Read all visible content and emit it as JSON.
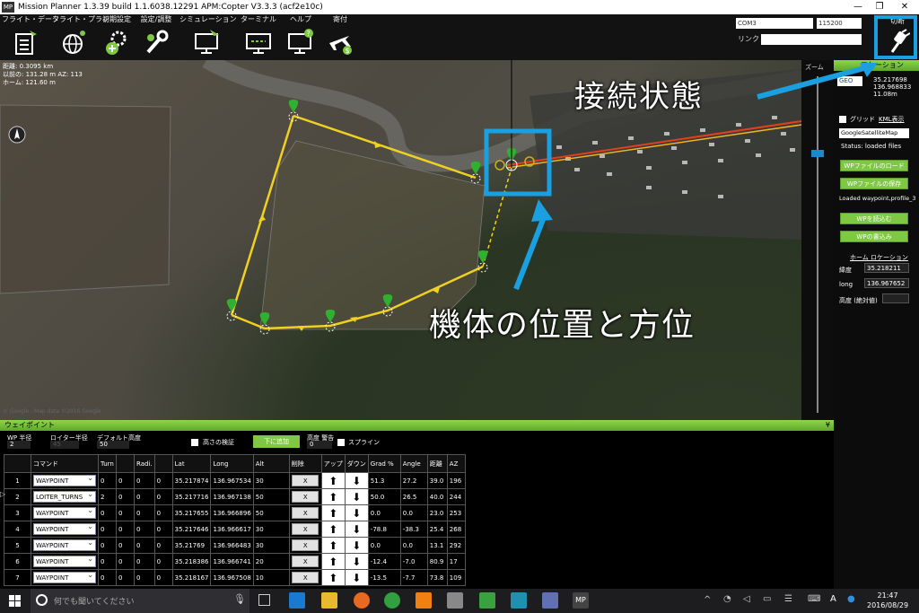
{
  "window": {
    "title": "Mission Planner 1.3.39 build 1.1.6038.12291 APM:Copter V3.3.3 (acf2e10c)",
    "logo": "MP"
  },
  "menu": [
    {
      "label": "フライト・データ",
      "icon": "flight-data-icon"
    },
    {
      "label": "フライト・プラン",
      "icon": "globe-icon"
    },
    {
      "label": "初期設定",
      "icon": "gear-plus-icon"
    },
    {
      "label": "設定/調整",
      "icon": "wrench-icon"
    },
    {
      "label": "シミュレーション",
      "icon": "monitor-plane-icon"
    },
    {
      "label": "ターミナル",
      "icon": "terminal-icon"
    },
    {
      "label": "ヘルプ",
      "icon": "help-icon"
    },
    {
      "label": "寄付",
      "icon": "donate-icon"
    }
  ],
  "connection": {
    "port": "COM3",
    "baud": "115200",
    "link_label": "リンク",
    "disconnect_label": "切断"
  },
  "map": {
    "distance": "距離: 0.3095 km",
    "prev": "以前の: 131.28 m AZ: 113",
    "home": "ホーム: 121.60 m",
    "zoom_label": "ズーム",
    "copyright": "© Google - Map data ©2016 Google"
  },
  "side": {
    "header": "ロケーション",
    "coord_mode": "GEO",
    "lat": "35.217698",
    "lng": "136.968833",
    "alt": "11.08m",
    "grid_label": "グリッド",
    "kml_label": "KML表示",
    "map_type": "GoogleSatelliteMap",
    "status": "Status: loaded files",
    "load_wp": "WPファイルのロード",
    "save_wp": "WPファイルの保存",
    "loaded_msg": "Loaded waypoint,profile_3",
    "read_wp": "WPを読込む",
    "write_wp": "WPの書込み",
    "home_location": "ホーム ロケーション",
    "home_lat_label": "緯度",
    "home_lat": "35.218211",
    "home_lng_label": "long",
    "home_lng": "136.967652",
    "home_alt_label": "高度 (絶対値)"
  },
  "waypoints": {
    "header": "ウェイポイント",
    "wp_radius_label": "WP 半径",
    "wp_radius": "2",
    "loiter_radius_label": "ロイター半径",
    "loiter_radius": "45",
    "default_alt_label": "デフォルト高度",
    "default_alt": "50",
    "verify_height_label": "高さの検証",
    "add_below_label": "下に追加",
    "alt_warn_label": "高度 警告",
    "alt_warn": "0",
    "spline_label": "スプライン",
    "columns": [
      "",
      "コマンド",
      "Turn",
      "",
      "Radi.",
      "",
      "Lat",
      "Long",
      "Alt",
      "削除",
      "アップ",
      "ダウン",
      "Grad %",
      "Angle",
      "距離",
      "AZ"
    ],
    "rows": [
      {
        "n": "1",
        "cmd": "WAYPOINT",
        "p1": "0",
        "p2": "0",
        "p3": "0",
        "p4": "0",
        "lat": "35.217874",
        "lng": "136.967534",
        "alt": "30",
        "del": "X",
        "grad": "51.3",
        "angle": "27.2",
        "dist": "39.0",
        "az": "196"
      },
      {
        "n": "2",
        "cmd": "LOITER_TURNS",
        "p1": "2",
        "p2": "0",
        "p3": "0",
        "p4": "0",
        "lat": "35.217716",
        "lng": "136.967138",
        "alt": "50",
        "del": "X",
        "grad": "50.0",
        "angle": "26.5",
        "dist": "40.0",
        "az": "244"
      },
      {
        "n": "3",
        "cmd": "WAYPOINT",
        "p1": "0",
        "p2": "0",
        "p3": "0",
        "p4": "0",
        "lat": "35.217655",
        "lng": "136.966896",
        "alt": "50",
        "del": "X",
        "grad": "0.0",
        "angle": "0.0",
        "dist": "23.0",
        "az": "253"
      },
      {
        "n": "4",
        "cmd": "WAYPOINT",
        "p1": "0",
        "p2": "0",
        "p3": "0",
        "p4": "0",
        "lat": "35.217646",
        "lng": "136.966617",
        "alt": "30",
        "del": "X",
        "grad": "-78.8",
        "angle": "-38.3",
        "dist": "25.4",
        "az": "268"
      },
      {
        "n": "5",
        "cmd": "WAYPOINT",
        "p1": "0",
        "p2": "0",
        "p3": "0",
        "p4": "0",
        "lat": "35.21769",
        "lng": "136.966483",
        "alt": "30",
        "del": "X",
        "grad": "0.0",
        "angle": "0.0",
        "dist": "13.1",
        "az": "292"
      },
      {
        "n": "6",
        "cmd": "WAYPOINT",
        "p1": "0",
        "p2": "0",
        "p3": "0",
        "p4": "0",
        "lat": "35.218386",
        "lng": "136.966741",
        "alt": "20",
        "del": "X",
        "grad": "-12.4",
        "angle": "-7.0",
        "dist": "80.9",
        "az": "17"
      },
      {
        "n": "7",
        "cmd": "WAYPOINT",
        "p1": "0",
        "p2": "0",
        "p3": "0",
        "p4": "0",
        "lat": "35.218167",
        "lng": "136.967508",
        "alt": "10",
        "del": "X",
        "grad": "-13.5",
        "angle": "-7.7",
        "dist": "73.8",
        "az": "109"
      }
    ]
  },
  "annotations": {
    "connection_state": "接続状態",
    "vehicle_pos": "機体の位置と方位"
  },
  "taskbar": {
    "search_placeholder": "何でも聞いてください",
    "time": "21:47",
    "date": "2016/08/29",
    "ime": "A"
  },
  "colors": {
    "accent_green": "#7ec843",
    "annotation_blue": "#1aa0e0",
    "route_yellow": "#f0d020"
  }
}
